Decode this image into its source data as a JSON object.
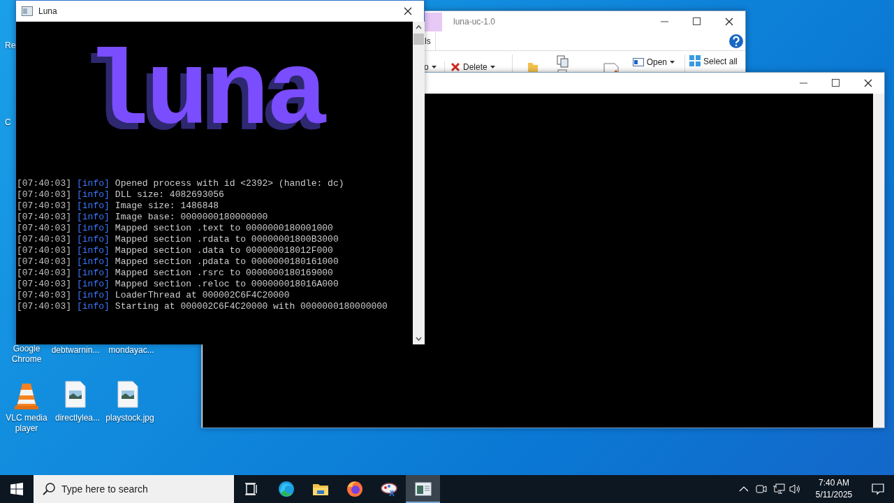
{
  "desktop_icons": [
    {
      "label": "Re",
      "kind": "bin"
    },
    {
      "label": "C",
      "kind": "shortcut"
    },
    {
      "label": "Google Chrome",
      "kind": "chrome"
    },
    {
      "label": "debtwarnin...",
      "kind": "hidden"
    },
    {
      "label": "mondayac...",
      "kind": "hidden"
    },
    {
      "label": "VLC media player",
      "kind": "vlc"
    },
    {
      "label": "directlylea...",
      "kind": "image"
    },
    {
      "label": "playstock.jpg",
      "kind": "image"
    }
  ],
  "explorer": {
    "title": "luna-uc-1.0",
    "tab": "ls",
    "ribbon": [
      {
        "label": "o",
        "kind": "dropdown"
      },
      {
        "label": "Delete",
        "kind": "delete"
      },
      {
        "label": "Open",
        "kind": "open"
      },
      {
        "label": "Select all",
        "kind": "selectall"
      }
    ]
  },
  "console": {
    "title": "Luna",
    "logo": "luna",
    "lines": [
      {
        "time": "[07:40:03]",
        "tag": "[info]",
        "message": "Opened process with id <2392> (handle: dc)"
      },
      {
        "time": "[07:40:03]",
        "tag": "[info]",
        "message": "DLL size: 4082693056"
      },
      {
        "time": "[07:40:03]",
        "tag": "[info]",
        "message": "Image size: 1486848"
      },
      {
        "time": "[07:40:03]",
        "tag": "[info]",
        "message": "Image base: 0000000180000000"
      },
      {
        "time": "[07:40:03]",
        "tag": "[info]",
        "message": "Mapped section .text to 0000000180001000"
      },
      {
        "time": "[07:40:03]",
        "tag": "[info]",
        "message": "Mapped section .rdata to 00000001800B3000"
      },
      {
        "time": "[07:40:03]",
        "tag": "[info]",
        "message": "Mapped section .data to 000000018012F000"
      },
      {
        "time": "[07:40:03]",
        "tag": "[info]",
        "message": "Mapped section .pdata to 0000000180161000"
      },
      {
        "time": "[07:40:03]",
        "tag": "[info]",
        "message": "Mapped section .rsrc to 0000000180169000"
      },
      {
        "time": "[07:40:03]",
        "tag": "[info]",
        "message": "Mapped section .reloc to 000000018016A000"
      },
      {
        "time": "[07:40:03]",
        "tag": "[info]",
        "message": "LoaderThread at 000002C6F4C20000"
      },
      {
        "time": "[07:40:03]",
        "tag": "[info]",
        "message": "Starting at 000002C6F4C20000 with 0000000180000000"
      }
    ]
  },
  "taskbar": {
    "search": {
      "placeholder": "Type here to search"
    },
    "apps": [
      {
        "kind": "taskview",
        "selected": false
      },
      {
        "kind": "edge",
        "selected": false
      },
      {
        "kind": "explorer",
        "selected": false
      },
      {
        "kind": "firefox",
        "selected": false
      },
      {
        "kind": "paint",
        "selected": false
      },
      {
        "kind": "console",
        "selected": true
      }
    ],
    "time": "7:40 AM",
    "date": "5/11/2025"
  }
}
